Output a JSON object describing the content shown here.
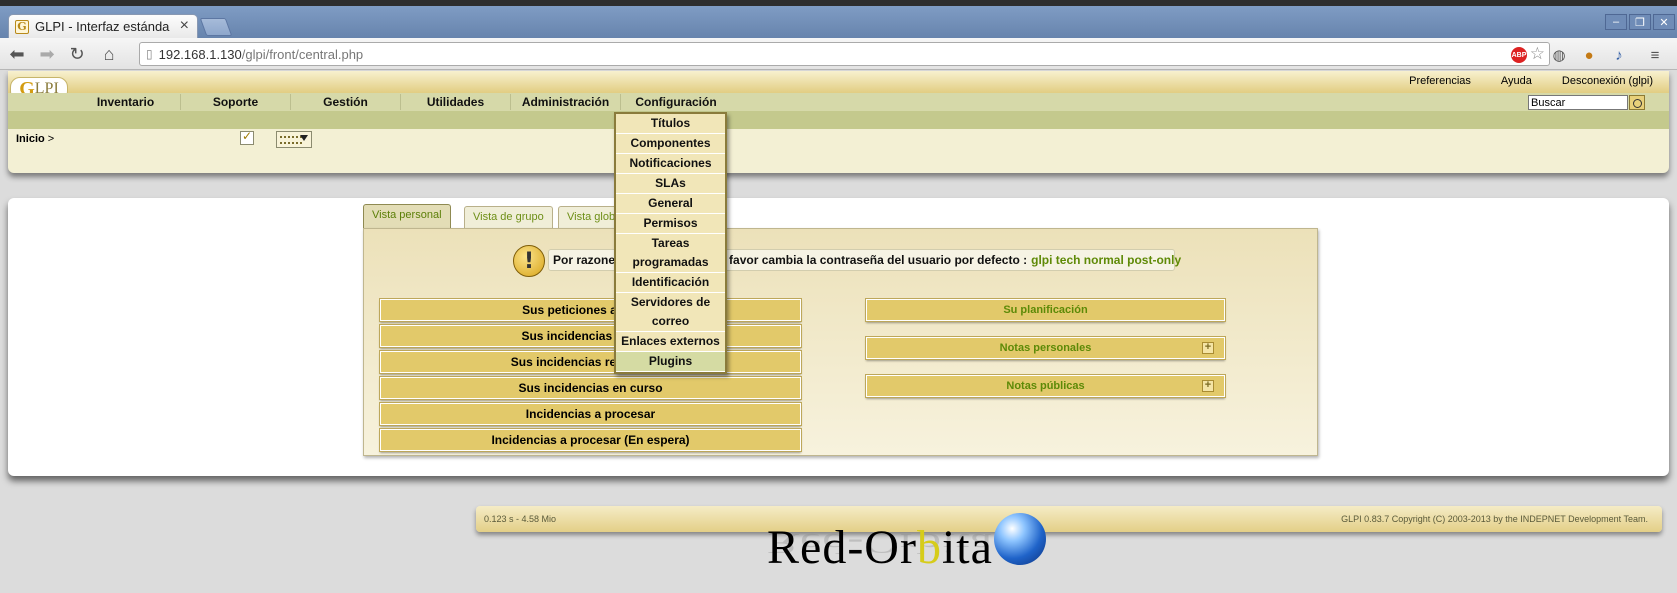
{
  "browser": {
    "tab_title": "GLPI - Interfaz estánda",
    "tab_favicon": "G",
    "tab_close": "×",
    "url_host": "192.168.1.130",
    "url_path": "/glpi/front/central.php",
    "abp_label": "ABP"
  },
  "header": {
    "logo_g": "G",
    "logo_text": "LPI",
    "top_links": [
      "Preferencias",
      "Ayuda",
      "Desconexión (glpi)"
    ],
    "menu": [
      "Inventario",
      "Soporte",
      "Gestión",
      "Utilidades",
      "Administración",
      "Configuración"
    ],
    "search_value": "Buscar",
    "breadcrumb": "Inicio",
    "breadcrumb_sep": ">"
  },
  "dropdown": {
    "items": [
      "Títulos",
      "Componentes",
      "Notificaciones",
      "SLAs",
      "General",
      "Permisos",
      "Tareas programadas",
      "Identificación",
      "Servidores de correo",
      "Enlaces externos",
      "Plugins"
    ],
    "highlighted": "Plugins"
  },
  "main": {
    "tabs": [
      "Vista personal",
      "Vista de grupo",
      "Vista glob"
    ],
    "warning_text": "Por razones de seguridad, por favor cambia la contraseña del usuario por defecto :",
    "warning_users": "glpi tech normal post-only",
    "left_buttons": [
      "Sus peticiones a validar",
      "Sus incidencias a cerrar",
      "Sus incidencias rechazadas",
      "Sus incidencias en curso",
      "Incidencias a procesar",
      "Incidencias a procesar (En espera)"
    ],
    "right_buttons": [
      "Su planificación",
      "Notas personales",
      "Notas públicas"
    ]
  },
  "footer": {
    "timing": "0.123 s - 4.58 Mio",
    "copyright": "GLPI 0.83.7 Copyright (C) 2003-2013 by the INDEPNET Development Team."
  },
  "watermark": {
    "text_a": "Red-Or",
    "text_b": "b",
    "text_c": "ita"
  },
  "colors": {
    "accent_green": "#5f8a07",
    "button_gold": "#e2c96a",
    "header_bg": "#f3f0d4"
  }
}
